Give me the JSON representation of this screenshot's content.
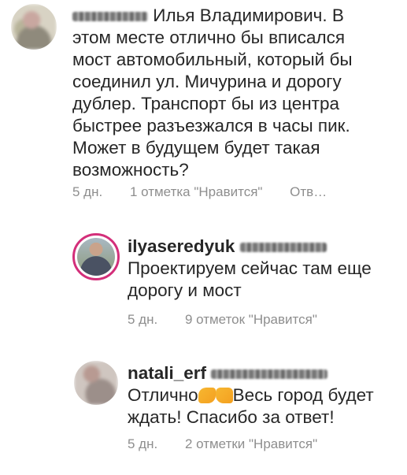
{
  "comments": [
    {
      "username": "",
      "text_lines": [
        "Илья Владимирович. В",
        "этом месте отлично бы вписался",
        "мост автомобильный, который бы",
        "соединил ул. Мичурина и дорогу",
        "дублер. Транспорт бы из центра",
        "быстрее разъезжался в часы пик.",
        "Может в будущем будет такая",
        "возможность?"
      ],
      "time": "5 дн.",
      "likes": "1 отметка \"Нравится\"",
      "reply": "Отв…"
    },
    {
      "username": "ilyaseredyuk",
      "text_lines": [
        "Проектируем сейчас там еще",
        "дорогу и мост"
      ],
      "time": "5 дн.",
      "likes": "9 отметок \"Нравится\""
    },
    {
      "username": "natali_erf",
      "text_lines": [
        "Отлично",
        "Весь город будет",
        "ждать! Спасибо за ответ!"
      ],
      "time": "5 дн.",
      "likes": "2 отметки \"Нравится\""
    }
  ],
  "icons": {
    "emoji_1": "handshake-emoji-icon",
    "emoji_2": "thumbs-up-emoji-icon"
  }
}
